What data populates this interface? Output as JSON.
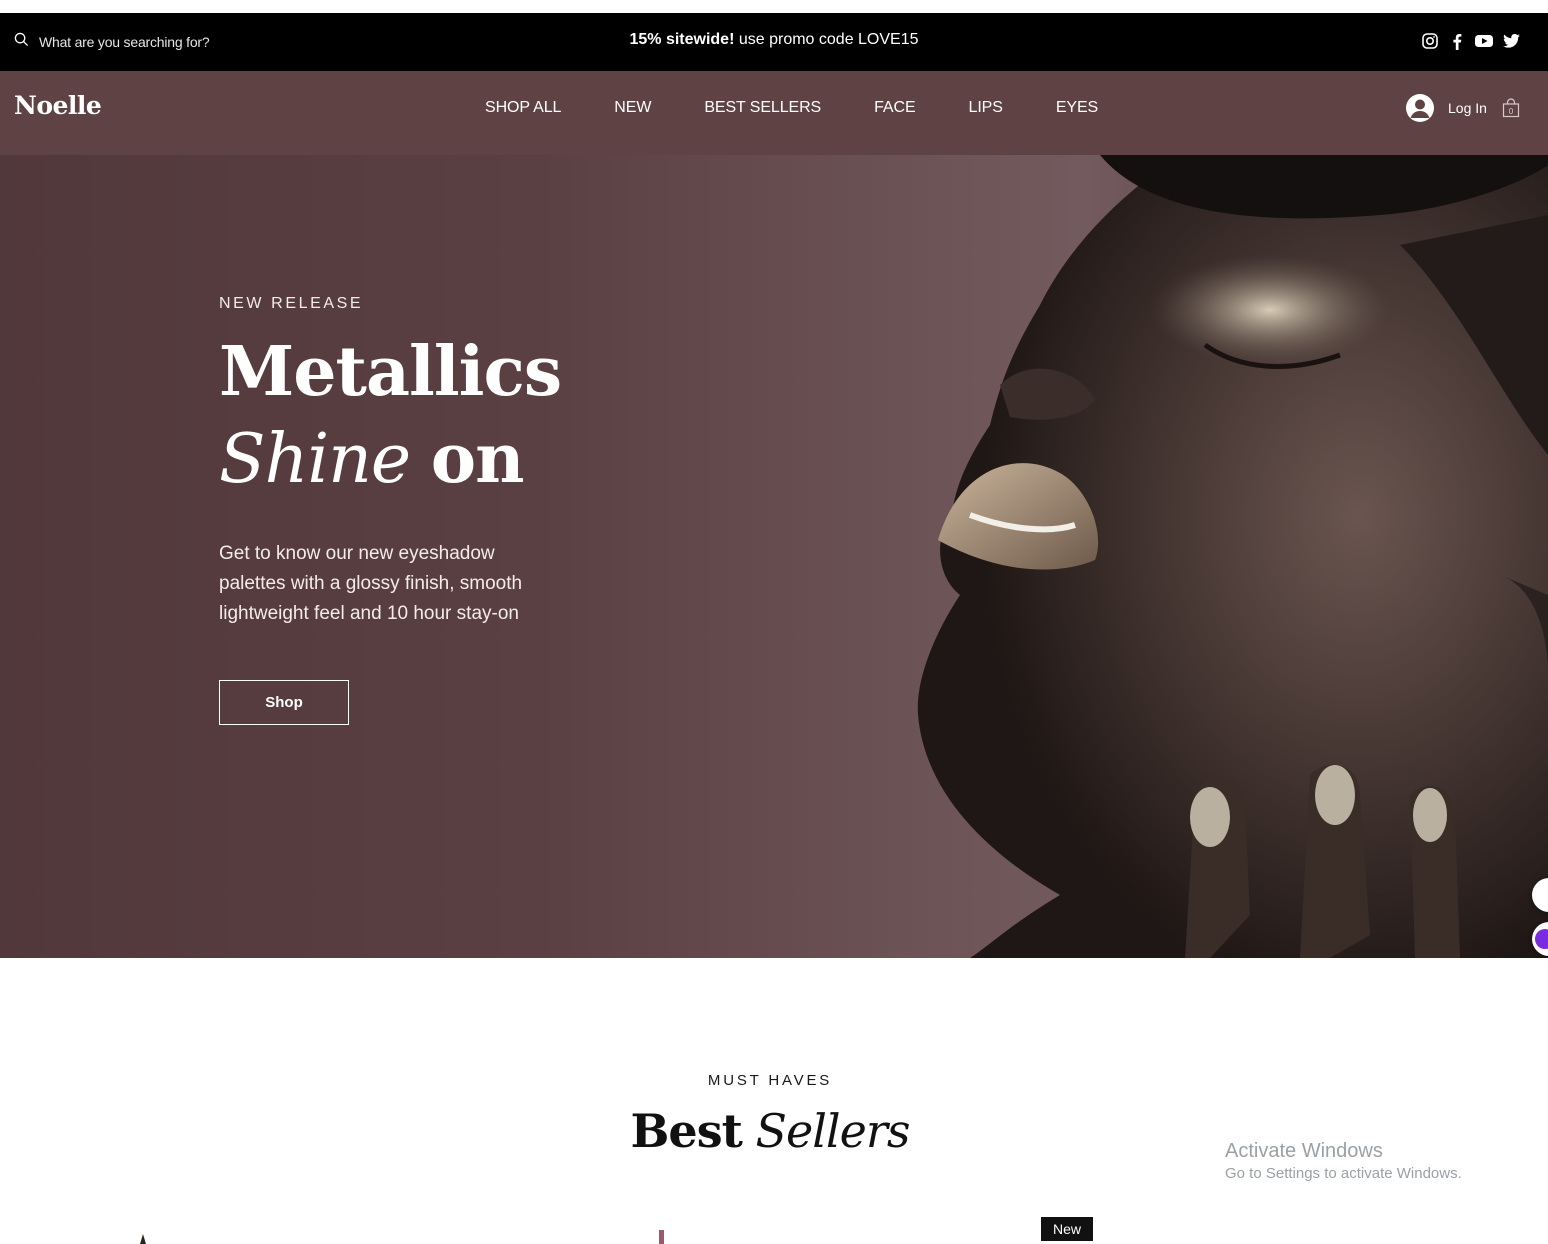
{
  "announcement": {
    "search_placeholder": "What are you searching for?",
    "promo_bold": "15% sitewide!",
    "promo_rest": " use promo code LOVE15",
    "social_icons": [
      "instagram-icon",
      "facebook-icon",
      "youtube-icon",
      "twitter-icon"
    ]
  },
  "header": {
    "logo": "Noelle",
    "nav": [
      "SHOP ALL",
      "NEW",
      "BEST SELLERS",
      "FACE",
      "LIPS",
      "EYES"
    ],
    "login_label": "Log In",
    "cart_count": "0"
  },
  "hero": {
    "eyebrow": "NEW RELEASE",
    "title_line1": "Metallics",
    "title_line2_italic": "Shine",
    "title_line2_bold": "on",
    "description": "Get to know our new eyeshadow palettes with a glossy finish, smooth lightweight feel and 10 hour stay-on",
    "cta": "Shop"
  },
  "best_sellers": {
    "eyebrow": "MUST HAVES",
    "heading_bold": "Best",
    "heading_italic": "Sellers",
    "badge": "New"
  },
  "os_watermark": {
    "line1": "Activate Windows",
    "line2": "Go to Settings to activate Windows."
  },
  "colors": {
    "announcement_bg": "#000000",
    "nav_bg": "#5e4244",
    "hero_bg": "#5b4043"
  }
}
